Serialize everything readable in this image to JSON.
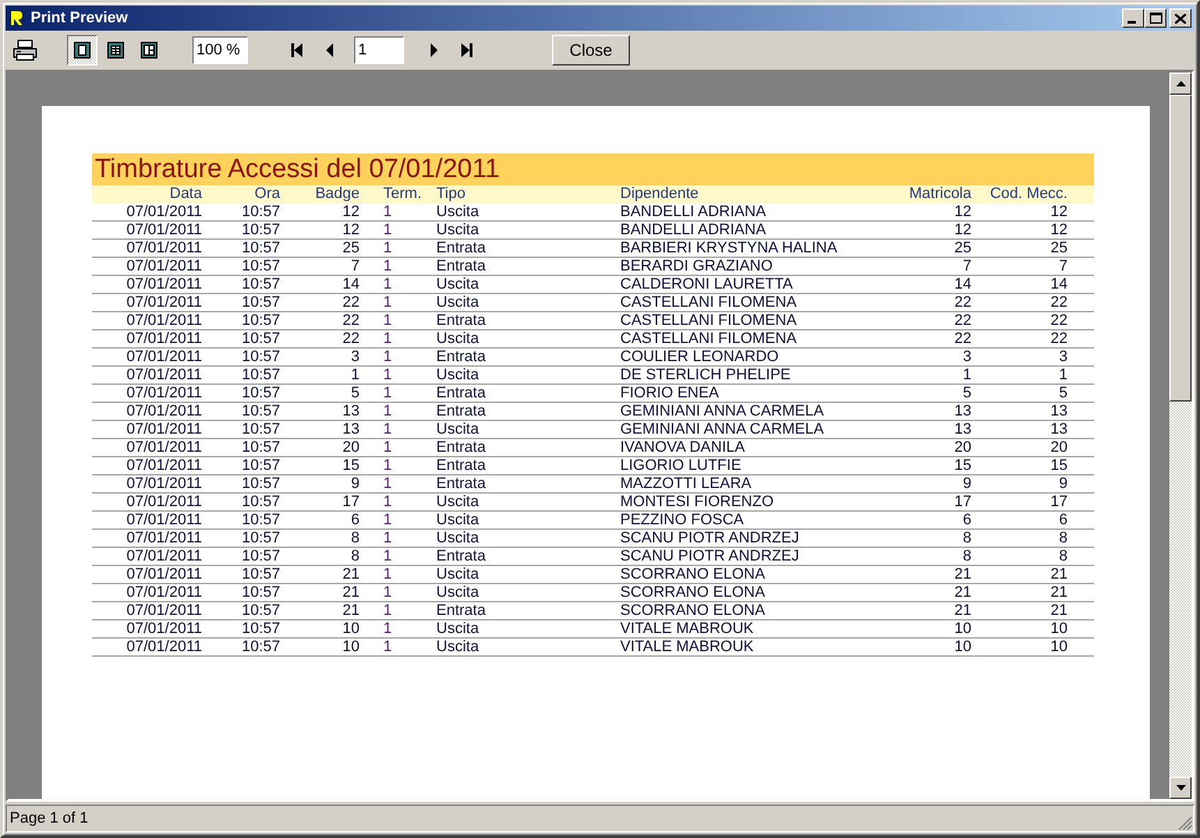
{
  "window": {
    "title": "Print Preview"
  },
  "toolbar": {
    "view_modes": [
      {
        "kind": "page",
        "selected": true
      },
      {
        "kind": "columns",
        "selected": false
      },
      {
        "kind": "grid",
        "selected": false
      }
    ],
    "zoom": "100 %",
    "page": "1",
    "close": "Close"
  },
  "report": {
    "title": "Timbrature Accessi del 07/01/2011",
    "columns": [
      "Data",
      "Ora",
      "Badge",
      "Term.",
      "Tipo",
      "Dipendente",
      "Matricola",
      "Cod. Mecc."
    ],
    "rows": [
      [
        "07/01/2011",
        "10:57",
        "12",
        "1",
        "Uscita",
        "BANDELLI ADRIANA",
        "12",
        "12"
      ],
      [
        "07/01/2011",
        "10:57",
        "12",
        "1",
        "Uscita",
        "BANDELLI ADRIANA",
        "12",
        "12"
      ],
      [
        "07/01/2011",
        "10:57",
        "25",
        "1",
        "Entrata",
        "BARBIERI KRYSTYNA HALINA",
        "25",
        "25"
      ],
      [
        "07/01/2011",
        "10:57",
        "7",
        "1",
        "Entrata",
        "BERARDI GRAZIANO",
        "7",
        "7"
      ],
      [
        "07/01/2011",
        "10:57",
        "14",
        "1",
        "Uscita",
        "CALDERONI LAURETTA",
        "14",
        "14"
      ],
      [
        "07/01/2011",
        "10:57",
        "22",
        "1",
        "Uscita",
        "CASTELLANI FILOMENA",
        "22",
        "22"
      ],
      [
        "07/01/2011",
        "10:57",
        "22",
        "1",
        "Entrata",
        "CASTELLANI FILOMENA",
        "22",
        "22"
      ],
      [
        "07/01/2011",
        "10:57",
        "22",
        "1",
        "Uscita",
        "CASTELLANI FILOMENA",
        "22",
        "22"
      ],
      [
        "07/01/2011",
        "10:57",
        "3",
        "1",
        "Entrata",
        "COULIER LEONARDO",
        "3",
        "3"
      ],
      [
        "07/01/2011",
        "10:57",
        "1",
        "1",
        "Uscita",
        "DE STERLICH PHELIPE",
        "1",
        "1"
      ],
      [
        "07/01/2011",
        "10:57",
        "5",
        "1",
        "Entrata",
        "FIORIO ENEA",
        "5",
        "5"
      ],
      [
        "07/01/2011",
        "10:57",
        "13",
        "1",
        "Entrata",
        "GEMINIANI ANNA CARMELA",
        "13",
        "13"
      ],
      [
        "07/01/2011",
        "10:57",
        "13",
        "1",
        "Uscita",
        "GEMINIANI ANNA CARMELA",
        "13",
        "13"
      ],
      [
        "07/01/2011",
        "10:57",
        "20",
        "1",
        "Entrata",
        "IVANOVA DANILA",
        "20",
        "20"
      ],
      [
        "07/01/2011",
        "10:57",
        "15",
        "1",
        "Entrata",
        "LIGORIO LUTFIE",
        "15",
        "15"
      ],
      [
        "07/01/2011",
        "10:57",
        "9",
        "1",
        "Entrata",
        "MAZZOTTI LEARA",
        "9",
        "9"
      ],
      [
        "07/01/2011",
        "10:57",
        "17",
        "1",
        "Uscita",
        "MONTESI FIORENZO",
        "17",
        "17"
      ],
      [
        "07/01/2011",
        "10:57",
        "6",
        "1",
        "Uscita",
        "PEZZINO FOSCA",
        "6",
        "6"
      ],
      [
        "07/01/2011",
        "10:57",
        "8",
        "1",
        "Uscita",
        "SCANU PIOTR ANDRZEJ",
        "8",
        "8"
      ],
      [
        "07/01/2011",
        "10:57",
        "8",
        "1",
        "Entrata",
        "SCANU PIOTR ANDRZEJ",
        "8",
        "8"
      ],
      [
        "07/01/2011",
        "10:57",
        "21",
        "1",
        "Uscita",
        "SCORRANO ELONA",
        "21",
        "21"
      ],
      [
        "07/01/2011",
        "10:57",
        "21",
        "1",
        "Uscita",
        "SCORRANO ELONA",
        "21",
        "21"
      ],
      [
        "07/01/2011",
        "10:57",
        "21",
        "1",
        "Entrata",
        "SCORRANO ELONA",
        "21",
        "21"
      ],
      [
        "07/01/2011",
        "10:57",
        "10",
        "1",
        "Uscita",
        "VITALE MABROUK",
        "10",
        "10"
      ],
      [
        "07/01/2011",
        "10:57",
        "10",
        "1",
        "Uscita",
        "VITALE MABROUK",
        "10",
        "10"
      ]
    ]
  },
  "status_bar": "Page 1 of 1"
}
